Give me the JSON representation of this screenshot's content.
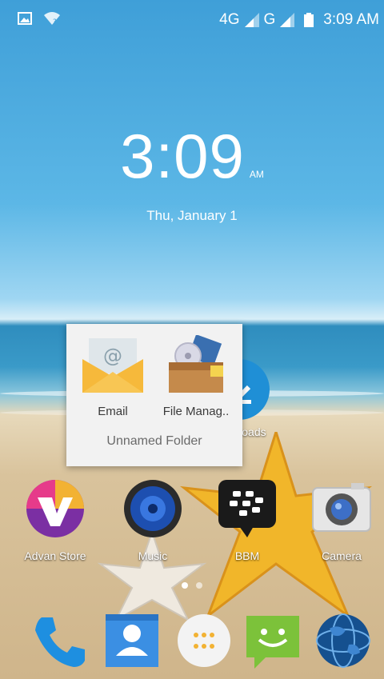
{
  "status_bar": {
    "network_4g": "4G",
    "network_g": "G",
    "time": "3:09 AM",
    "icons": [
      "image-notification-icon",
      "wifi-unknown-icon",
      "signal-4g-icon",
      "signal-g-icon",
      "battery-icon"
    ]
  },
  "clock_widget": {
    "time": "3:09",
    "ampm": "AM",
    "date": "Thu, January 1"
  },
  "folder": {
    "name": "Unnamed Folder",
    "apps": [
      {
        "label": "Email",
        "icon": "email-icon"
      },
      {
        "label": "File Manag..",
        "icon": "file-manager-icon"
      }
    ]
  },
  "downloads": {
    "label": "nloads",
    "icon": "downloads-icon"
  },
  "home_apps": [
    {
      "label": "Advan Store",
      "icon": "advan-store-icon"
    },
    {
      "label": "Music",
      "icon": "music-icon"
    },
    {
      "label": "BBM",
      "icon": "bbm-icon"
    },
    {
      "label": "Camera",
      "icon": "camera-icon"
    }
  ],
  "dock": [
    {
      "icon": "phone-icon"
    },
    {
      "icon": "contacts-icon"
    },
    {
      "icon": "app-drawer-icon"
    },
    {
      "icon": "messaging-icon"
    },
    {
      "icon": "browser-icon"
    }
  ],
  "page_indicator": {
    "pages": 2,
    "active": 1
  },
  "colors": {
    "accent": "#1f8fd6",
    "folder_bg": "#f2f2f2"
  }
}
